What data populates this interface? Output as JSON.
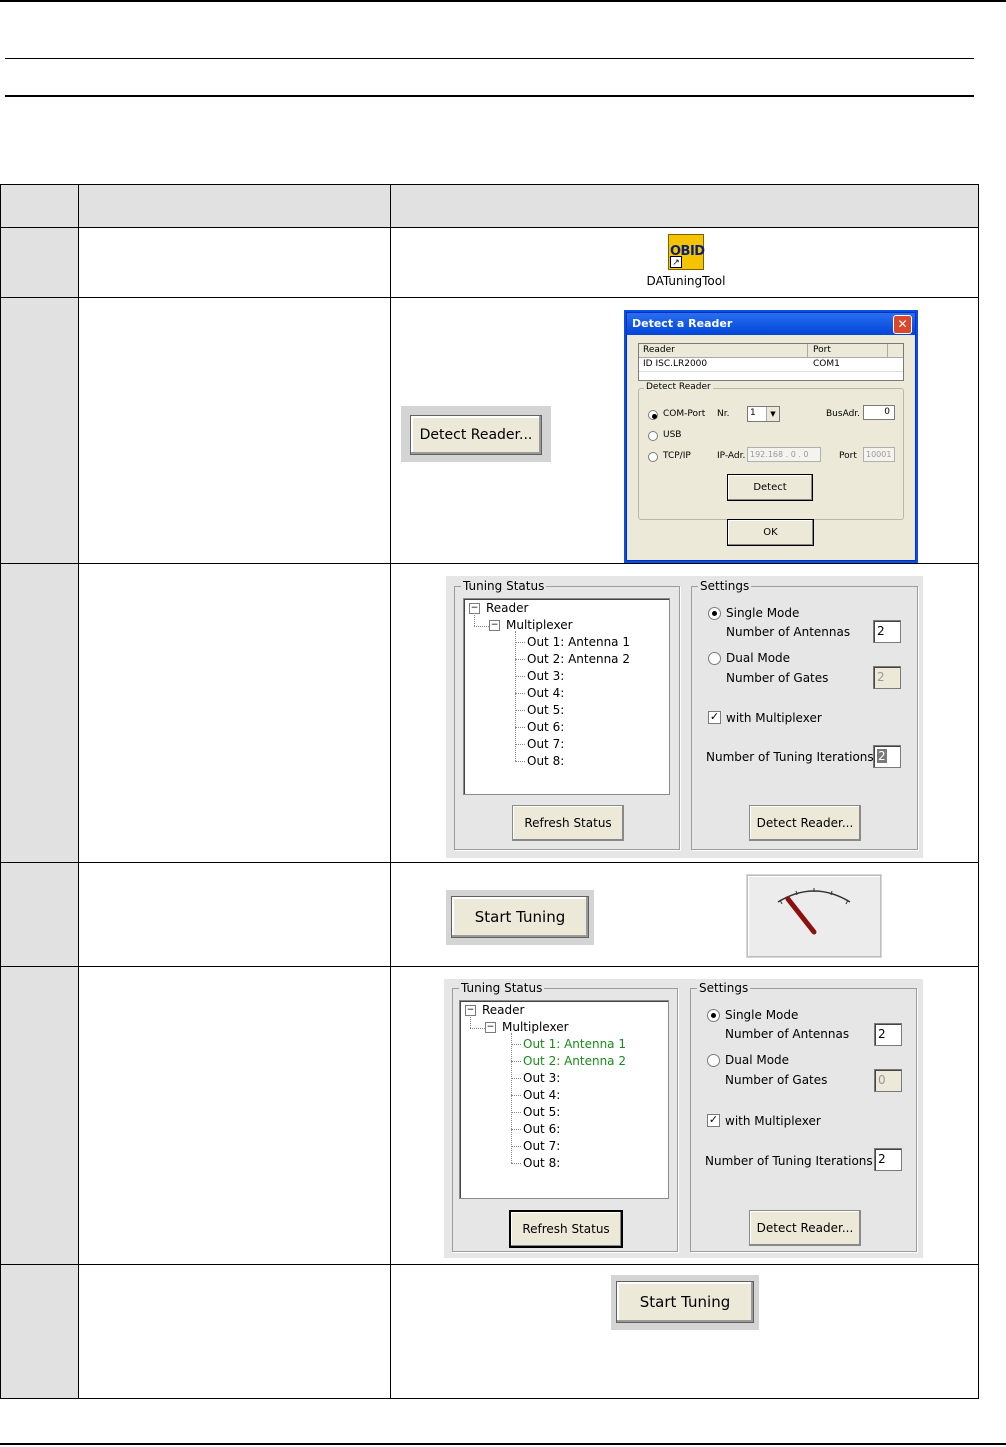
{
  "desktop_icon": {
    "logo_text": "OBID",
    "label": "DATuningTool"
  },
  "detect_reader_button": "Detect Reader...",
  "detect_dialog": {
    "title": "Detect a Reader",
    "table_headers": [
      "Reader",
      "Port"
    ],
    "table_row": [
      "ID ISC.LR2000",
      "COM1"
    ],
    "group_label": "Detect Reader",
    "com_port_label": "COM-Port",
    "nr_label": "Nr.",
    "nr_value": "1",
    "busadr_label": "BusAdr.",
    "busadr_value": "0",
    "usb_label": "USB",
    "tcpip_label": "TCP/IP",
    "ipadr_label": "IP-Adr.",
    "ipadr_value": "192.168 . 0 . 0",
    "port_label": "Port",
    "port_value": "10001",
    "detect_button": "Detect",
    "ok_button": "OK"
  },
  "panel1": {
    "tuning_status_label": "Tuning Status",
    "tree_root": "Reader",
    "tree_mux": "Multiplexer",
    "outputs": [
      "Out 1: Antenna 1",
      "Out 2: Antenna 2",
      "Out 3:",
      "Out 4:",
      "Out 5:",
      "Out 6:",
      "Out 7:",
      "Out 8:"
    ],
    "refresh_button": "Refresh Status",
    "settings_label": "Settings",
    "single_mode": "Single Mode",
    "num_antennas_label": "Number of Antennas",
    "num_antennas_value": "2",
    "dual_mode": "Dual Mode",
    "num_gates_label": "Number of Gates",
    "num_gates_value": "2",
    "with_mux": "with Multiplexer",
    "iterations_label": "Number of Tuning Iterations",
    "iterations_value": "2",
    "detect_button": "Detect Reader..."
  },
  "start_tuning_button": "Start Tuning",
  "panel2": {
    "tuning_status_label": "Tuning Status",
    "tree_root": "Reader",
    "tree_mux": "Multiplexer",
    "outputs": [
      "Out 1: Antenna 1",
      "Out 2: Antenna 2",
      "Out 3:",
      "Out 4:",
      "Out 5:",
      "Out 6:",
      "Out 7:",
      "Out 8:"
    ],
    "refresh_button": "Refresh Status",
    "settings_label": "Settings",
    "single_mode": "Single Mode",
    "num_antennas_label": "Number of Antennas",
    "num_antennas_value": "2",
    "dual_mode": "Dual Mode",
    "num_gates_label": "Number of Gates",
    "num_gates_value": "0",
    "with_mux": "with Multiplexer",
    "iterations_label": "Number of Tuning Iterations",
    "iterations_value": "2",
    "detect_button": "Detect Reader..."
  },
  "start_tuning_button_2": "Start Tuning"
}
